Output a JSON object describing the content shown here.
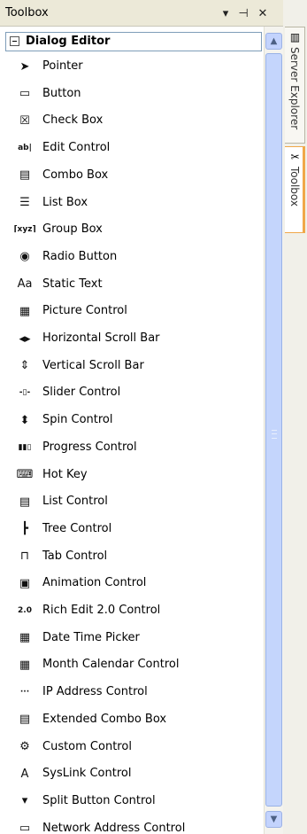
{
  "window": {
    "title": "Toolbox",
    "dropdown_glyph": "▾",
    "pin_glyph": "⊣",
    "close_glyph": "✕"
  },
  "group": {
    "label": "Dialog Editor"
  },
  "items": [
    {
      "label": "Pointer",
      "icon": "pointer-icon",
      "glyph": "➤"
    },
    {
      "label": "Button",
      "icon": "button-icon",
      "glyph": "▭"
    },
    {
      "label": "Check Box",
      "icon": "checkbox-icon",
      "glyph": "☒"
    },
    {
      "label": "Edit Control",
      "icon": "edit-control-icon",
      "glyph": "ab|"
    },
    {
      "label": "Combo Box",
      "icon": "combo-box-icon",
      "glyph": "▤"
    },
    {
      "label": "List Box",
      "icon": "list-box-icon",
      "glyph": "☰"
    },
    {
      "label": "Group Box",
      "icon": "group-box-icon",
      "glyph": "⌈xyz⌉"
    },
    {
      "label": "Radio Button",
      "icon": "radio-button-icon",
      "glyph": "◉"
    },
    {
      "label": "Static Text",
      "icon": "static-text-icon",
      "glyph": "Aa"
    },
    {
      "label": "Picture Control",
      "icon": "picture-control-icon",
      "glyph": "▦"
    },
    {
      "label": "Horizontal Scroll Bar",
      "icon": "horizontal-scroll-bar-icon",
      "glyph": "◂▸"
    },
    {
      "label": "Vertical Scroll Bar",
      "icon": "vertical-scroll-bar-icon",
      "glyph": "⇕"
    },
    {
      "label": "Slider Control",
      "icon": "slider-control-icon",
      "glyph": "-▯-"
    },
    {
      "label": "Spin Control",
      "icon": "spin-control-icon",
      "glyph": "⬍"
    },
    {
      "label": "Progress Control",
      "icon": "progress-control-icon",
      "glyph": "▮▮▯"
    },
    {
      "label": "Hot Key",
      "icon": "hot-key-icon",
      "glyph": "⌨"
    },
    {
      "label": "List Control",
      "icon": "list-control-icon",
      "glyph": "▤"
    },
    {
      "label": "Tree Control",
      "icon": "tree-control-icon",
      "glyph": "┣"
    },
    {
      "label": "Tab Control",
      "icon": "tab-control-icon",
      "glyph": "⊓"
    },
    {
      "label": "Animation Control",
      "icon": "animation-control-icon",
      "glyph": "▣"
    },
    {
      "label": "Rich Edit 2.0 Control",
      "icon": "rich-edit-icon",
      "glyph": "2.0"
    },
    {
      "label": "Date Time Picker",
      "icon": "date-time-picker-icon",
      "glyph": "▦"
    },
    {
      "label": "Month Calendar Control",
      "icon": "month-calendar-icon",
      "glyph": "▦"
    },
    {
      "label": "IP Address Control",
      "icon": "ip-address-icon",
      "glyph": "···"
    },
    {
      "label": "Extended Combo Box",
      "icon": "extended-combo-box-icon",
      "glyph": "▤"
    },
    {
      "label": "Custom Control",
      "icon": "custom-control-icon",
      "glyph": "⚙"
    },
    {
      "label": "SysLink Control",
      "icon": "syslink-control-icon",
      "glyph": "A"
    },
    {
      "label": "Split Button Control",
      "icon": "split-button-control-icon",
      "glyph": "▾"
    },
    {
      "label": "Network Address Control",
      "icon": "network-address-control-icon",
      "glyph": "▭"
    }
  ],
  "scrollbar": {
    "up_glyph": "▲",
    "down_glyph": "▼",
    "thumb_fraction": 0.93
  },
  "dock_tabs": [
    {
      "label": "Server Explorer",
      "icon": "server-explorer-icon",
      "glyph": "▥",
      "active": false
    },
    {
      "label": "Toolbox",
      "icon": "toolbox-icon",
      "glyph": "✂",
      "active": true
    }
  ],
  "colors": {
    "title_bg": "#ece9d8",
    "scroll_thumb": "#c4d5fc",
    "active_tab_accent": "#f0a849"
  }
}
